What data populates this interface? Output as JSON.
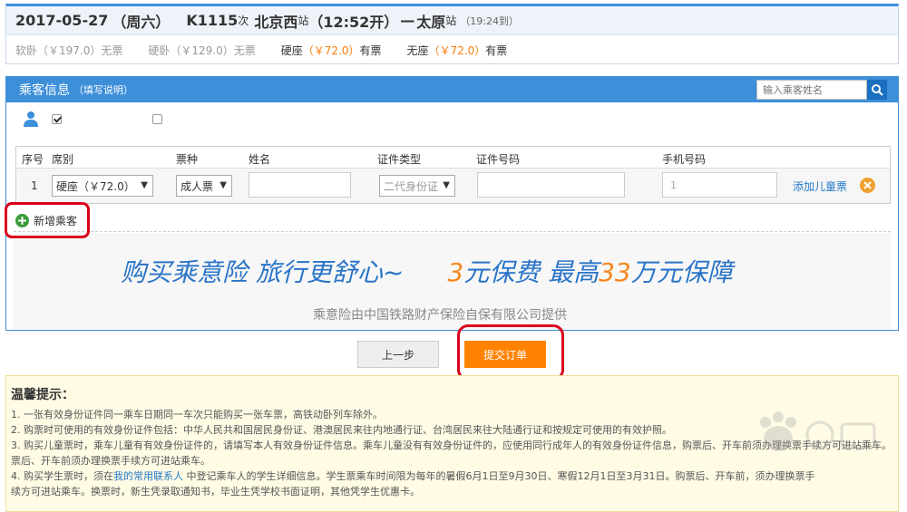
{
  "train": {
    "date": "2017-05-27",
    "weekday": "（周六）",
    "number": "K1115",
    "ci": "次",
    "from_station": "北京西",
    "zhan": "站",
    "depart": "（12:52开）",
    "dash": "—",
    "to_station": "太原",
    "to_zhan": "站",
    "arrive": "（19:24到）",
    "seats": [
      {
        "name": "软卧",
        "price": "（￥197.0）",
        "status": "无票",
        "available": false
      },
      {
        "name": "硬卧",
        "price": "（￥129.0）",
        "status": "无票",
        "available": false
      },
      {
        "name": "硬座",
        "price": "（￥72.0）",
        "status": "有票",
        "available": true
      },
      {
        "name": "无座",
        "price": "（￥72.0）",
        "status": "有票",
        "available": true
      }
    ]
  },
  "passenger_panel": {
    "title": "乘客信息",
    "note": "（填写说明）",
    "search_placeholder": "输入乘客姓名",
    "columns": [
      "序号",
      "席别",
      "票种",
      "姓名",
      "证件类型",
      "证件号码",
      "手机号码"
    ],
    "row": {
      "index": "1",
      "seat": "硬座（￥72.0）",
      "ticket_type": "成人票",
      "name": "",
      "id_type": "二代身份证",
      "id_number": "",
      "phone": "1",
      "add_child": "添加儿童票"
    },
    "add_passenger": "新增乘客"
  },
  "banner": {
    "part1": "购买乘意险  旅行更舒心~",
    "num1": "3",
    "part2": "元保费  最高",
    "num2": "33",
    "part3": "万元保障",
    "sub": "乘意险由中国铁路财产保险自保有限公司提供"
  },
  "buttons": {
    "prev": "上一步",
    "submit": "提交订单"
  },
  "tips": {
    "title": "温馨提示：",
    "items": [
      "1. 一张有效身份证件同一乘车日期同一车次只能购买一张车票，高铁动卧列车除外。",
      "2. 购票时可使用的有效身份证件包括：中华人民共和国居民身份证、港澳居民来往内地通行证、台湾居民来往大陆通行证和按规定可使用的有效护照。",
      "3. 购买儿童票时，乘车儿童有有效身份证件的，请填写本人有效身份证件信息。乘车儿童没有有效身份证件的，应使用同行成年人的有效身份证件信息，购票后、开车前须办理换票手续方可进站乘车。",
      "票后、开车前须办理换票手续方可进站乘车。"
    ],
    "item4_pre": "4. 购买学生票时，须在",
    "item4_link": "我的常用联系人",
    "item4_post": " 中登记乘车人的学生详细信息。学生票乘车时间限为每年的暑假6月1日至9月30日、寒假12月1日至3月31日。购票后、开车前，须办理换票手",
    "item5": "续方可进站乘车。换票时，新生凭录取通知书，毕业生凭学校书面证明，其他凭学生优惠卡。"
  },
  "colors": {
    "accent_blue": "#3d8fd9",
    "orange": "#ff8200",
    "highlight_red": "#d9001b"
  }
}
